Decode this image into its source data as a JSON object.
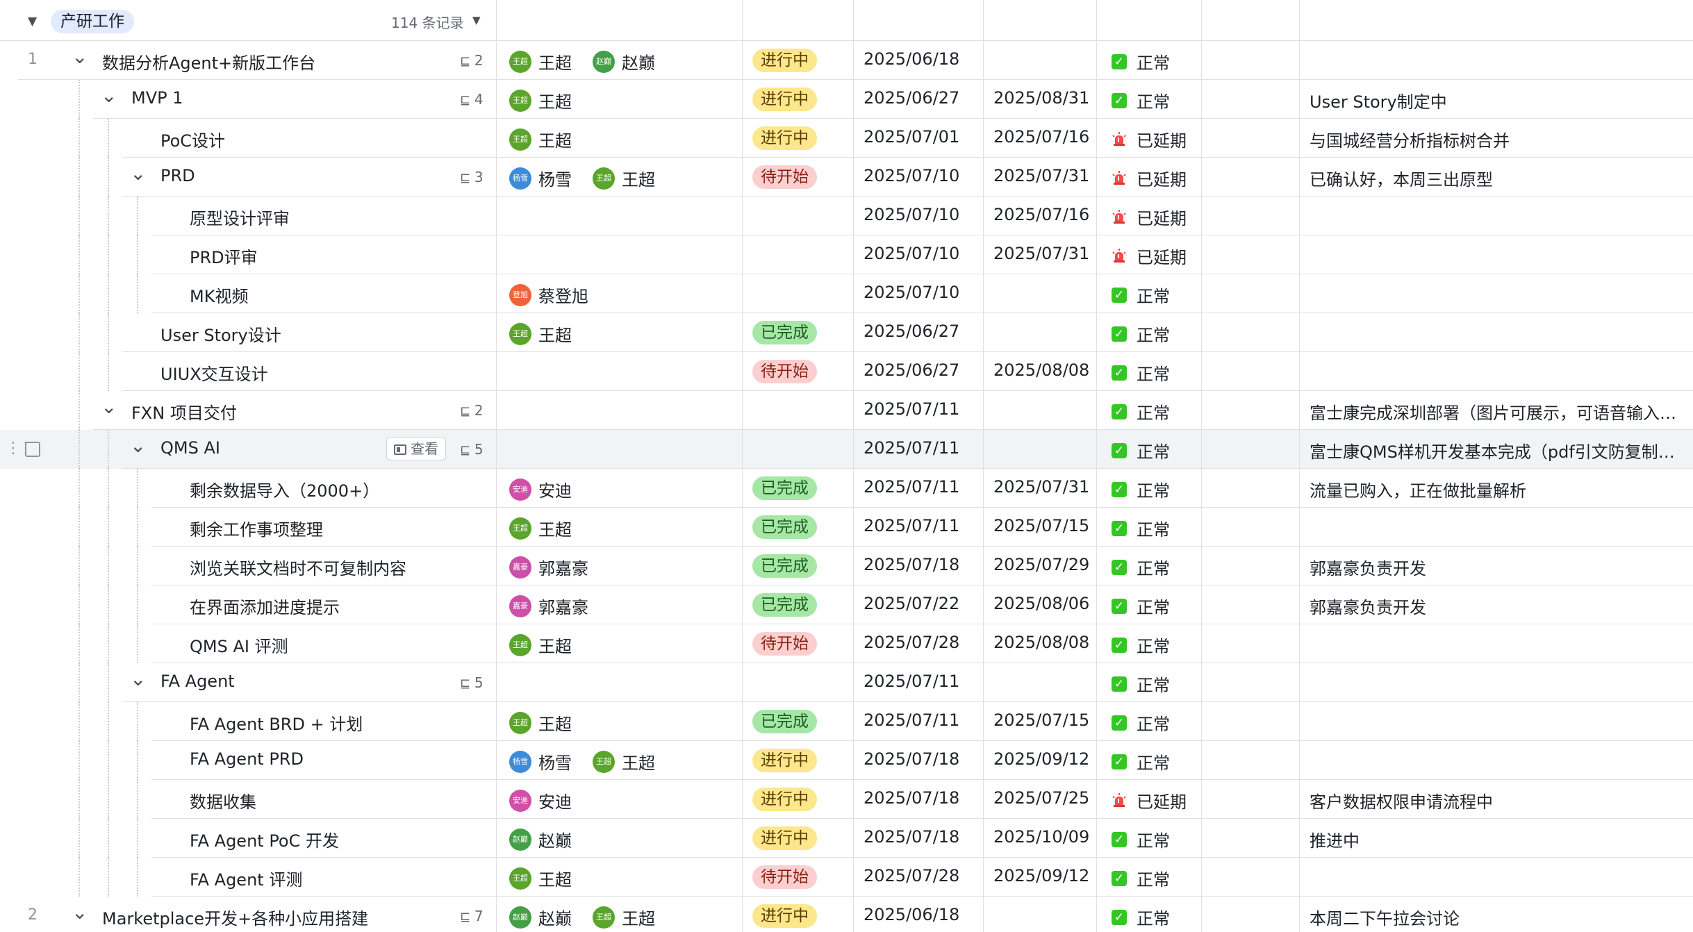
{
  "group": {
    "name": "产研工作",
    "count": "114 条记录"
  },
  "status_colors": {
    "进行中": {
      "bg": "#fde78c",
      "fg": "#5c3e00"
    },
    "待开始": {
      "bg": "#fbcfcf",
      "fg": "#8a1f11"
    },
    "已完成": {
      "bg": "#a6e7a6",
      "fg": "#1b5e20"
    }
  },
  "progress_icons": {
    "正常": "green-check-icon",
    "已延期": "red-alarm-light-icon"
  },
  "avatar_colors": {
    "王超": "#5aa52a",
    "赵巅": "#43a047",
    "杨雪": "#3d8bd9",
    "蔡登旭": "#f0643c",
    "安迪": "#d14fa6",
    "郭嘉豪": "#cc4fa8"
  },
  "rows": [
    {
      "num": "1",
      "level": 0,
      "expand": "v",
      "title": "数据分析Agent+新版工作台",
      "sub": "2",
      "people": [
        {
          "name": "王超",
          "abbr": "王超"
        },
        {
          "name": "赵巅",
          "abbr": "赵巅"
        }
      ],
      "status": "进行中",
      "start": "2025/06/18",
      "end": "",
      "progress": "正常",
      "note": ""
    },
    {
      "num": "",
      "level": 1,
      "expand": "v",
      "title": "MVP 1",
      "sub": "4",
      "people": [
        {
          "name": "王超",
          "abbr": "王超"
        }
      ],
      "status": "进行中",
      "start": "2025/06/27",
      "end": "2025/08/31",
      "progress": "正常",
      "note": "User Story制定中"
    },
    {
      "num": "",
      "level": 2,
      "expand": "",
      "title": "PoC设计",
      "sub": "",
      "people": [
        {
          "name": "王超",
          "abbr": "王超"
        }
      ],
      "status": "进行中",
      "start": "2025/07/01",
      "end": "2025/07/16",
      "progress": "已延期",
      "note": "与国城经营分析指标树合并"
    },
    {
      "num": "",
      "level": 2,
      "expand": "v",
      "title": "PRD",
      "sub": "3",
      "people": [
        {
          "name": "杨雪",
          "abbr": "杨雪"
        },
        {
          "name": "王超",
          "abbr": "王超"
        }
      ],
      "status": "待开始",
      "start": "2025/07/10",
      "end": "2025/07/31",
      "progress": "已延期",
      "note": "已确认好，本周三出原型"
    },
    {
      "num": "",
      "level": 3,
      "expand": "",
      "title": "原型设计评审",
      "sub": "",
      "people": [],
      "status": "",
      "start": "2025/07/10",
      "end": "2025/07/16",
      "progress": "已延期",
      "note": ""
    },
    {
      "num": "",
      "level": 3,
      "expand": "",
      "title": "PRD评审",
      "sub": "",
      "people": [],
      "status": "",
      "start": "2025/07/10",
      "end": "2025/07/31",
      "progress": "已延期",
      "note": ""
    },
    {
      "num": "",
      "level": 3,
      "expand": "",
      "title": "MK视频",
      "sub": "",
      "people": [
        {
          "name": "蔡登旭",
          "abbr": "登旭"
        }
      ],
      "status": "",
      "start": "2025/07/10",
      "end": "",
      "progress": "正常",
      "note": ""
    },
    {
      "num": "",
      "level": 2,
      "expand": "",
      "title": "User Story设计",
      "sub": "",
      "people": [
        {
          "name": "王超",
          "abbr": "王超"
        }
      ],
      "status": "已完成",
      "start": "2025/06/27",
      "end": "",
      "progress": "正常",
      "note": ""
    },
    {
      "num": "",
      "level": 2,
      "expand": "",
      "title": "UIUX交互设计",
      "sub": "",
      "people": [],
      "status": "待开始",
      "start": "2025/06/27",
      "end": "2025/08/08",
      "progress": "正常",
      "note": ""
    },
    {
      "num": "",
      "level": 1,
      "expand": "v",
      "title": "FXN 项目交付",
      "sub": "2",
      "people": [],
      "status": "",
      "start": "2025/07/11",
      "end": "",
      "progress": "正常",
      "note": "富士康完成深圳部署（图片可展示，可语音输入…"
    },
    {
      "num": "",
      "level": 2,
      "expand": "v",
      "title": "QMS AI",
      "sub": "5",
      "people": [],
      "status": "",
      "start": "2025/07/11",
      "end": "",
      "progress": "正常",
      "note": "富士康QMS样机开发基本完成（pdf引文防复制…",
      "highlight": true,
      "view": "查看"
    },
    {
      "num": "",
      "level": 3,
      "expand": "",
      "title": "剩余数据导入（2000+）",
      "sub": "",
      "people": [
        {
          "name": "安迪",
          "abbr": "安迪"
        }
      ],
      "status": "已完成",
      "start": "2025/07/11",
      "end": "2025/07/31",
      "progress": "正常",
      "note": "流量已购入，正在做批量解析"
    },
    {
      "num": "",
      "level": 3,
      "expand": "",
      "title": "剩余工作事项整理",
      "sub": "",
      "people": [
        {
          "name": "王超",
          "abbr": "王超"
        }
      ],
      "status": "已完成",
      "start": "2025/07/11",
      "end": "2025/07/15",
      "progress": "正常",
      "note": ""
    },
    {
      "num": "",
      "level": 3,
      "expand": "",
      "title": "浏览关联文档时不可复制内容",
      "sub": "",
      "people": [
        {
          "name": "郭嘉豪",
          "abbr": "嘉豪"
        }
      ],
      "status": "已完成",
      "start": "2025/07/18",
      "end": "2025/07/29",
      "progress": "正常",
      "note": "郭嘉豪负责开发"
    },
    {
      "num": "",
      "level": 3,
      "expand": "",
      "title": "在界面添加进度提示",
      "sub": "",
      "people": [
        {
          "name": "郭嘉豪",
          "abbr": "嘉豪"
        }
      ],
      "status": "已完成",
      "start": "2025/07/22",
      "end": "2025/08/06",
      "progress": "正常",
      "note": "郭嘉豪负责开发"
    },
    {
      "num": "",
      "level": 3,
      "expand": "",
      "title": "QMS AI 评测",
      "sub": "",
      "people": [
        {
          "name": "王超",
          "abbr": "王超"
        }
      ],
      "status": "待开始",
      "start": "2025/07/28",
      "end": "2025/08/08",
      "progress": "正常",
      "note": ""
    },
    {
      "num": "",
      "level": 2,
      "expand": "v",
      "title": "FA Agent",
      "sub": "5",
      "people": [],
      "status": "",
      "start": "2025/07/11",
      "end": "",
      "progress": "正常",
      "note": ""
    },
    {
      "num": "",
      "level": 3,
      "expand": "",
      "title": "FA Agent BRD + 计划",
      "sub": "",
      "people": [
        {
          "name": "王超",
          "abbr": "王超"
        }
      ],
      "status": "已完成",
      "start": "2025/07/11",
      "end": "2025/07/15",
      "progress": "正常",
      "note": ""
    },
    {
      "num": "",
      "level": 3,
      "expand": "",
      "title": "FA Agent PRD",
      "sub": "",
      "people": [
        {
          "name": "杨雪",
          "abbr": "杨雪"
        },
        {
          "name": "王超",
          "abbr": "王超"
        }
      ],
      "status": "进行中",
      "start": "2025/07/18",
      "end": "2025/09/12",
      "progress": "正常",
      "note": ""
    },
    {
      "num": "",
      "level": 3,
      "expand": "",
      "title": "数据收集",
      "sub": "",
      "people": [
        {
          "name": "安迪",
          "abbr": "安迪"
        }
      ],
      "status": "进行中",
      "start": "2025/07/18",
      "end": "2025/07/25",
      "progress": "已延期",
      "note": "客户数据权限申请流程中"
    },
    {
      "num": "",
      "level": 3,
      "expand": "",
      "title": "FA Agent PoC 开发",
      "sub": "",
      "people": [
        {
          "name": "赵巅",
          "abbr": "赵巅"
        }
      ],
      "status": "进行中",
      "start": "2025/07/18",
      "end": "2025/10/09",
      "progress": "正常",
      "note": "推进中"
    },
    {
      "num": "",
      "level": 3,
      "expand": "",
      "title": "FA Agent 评测",
      "sub": "",
      "people": [
        {
          "name": "王超",
          "abbr": "王超"
        }
      ],
      "status": "待开始",
      "start": "2025/07/28",
      "end": "2025/09/12",
      "progress": "正常",
      "note": ""
    },
    {
      "num": "2",
      "level": 0,
      "expand": "v",
      "title": "Marketplace开发+各种小应用搭建",
      "sub": "7",
      "people": [
        {
          "name": "赵巅",
          "abbr": "赵巅"
        },
        {
          "name": "王超",
          "abbr": "王超"
        }
      ],
      "status": "进行中",
      "start": "2025/06/18",
      "end": "",
      "progress": "正常",
      "note": "本周二下午拉会讨论"
    }
  ]
}
